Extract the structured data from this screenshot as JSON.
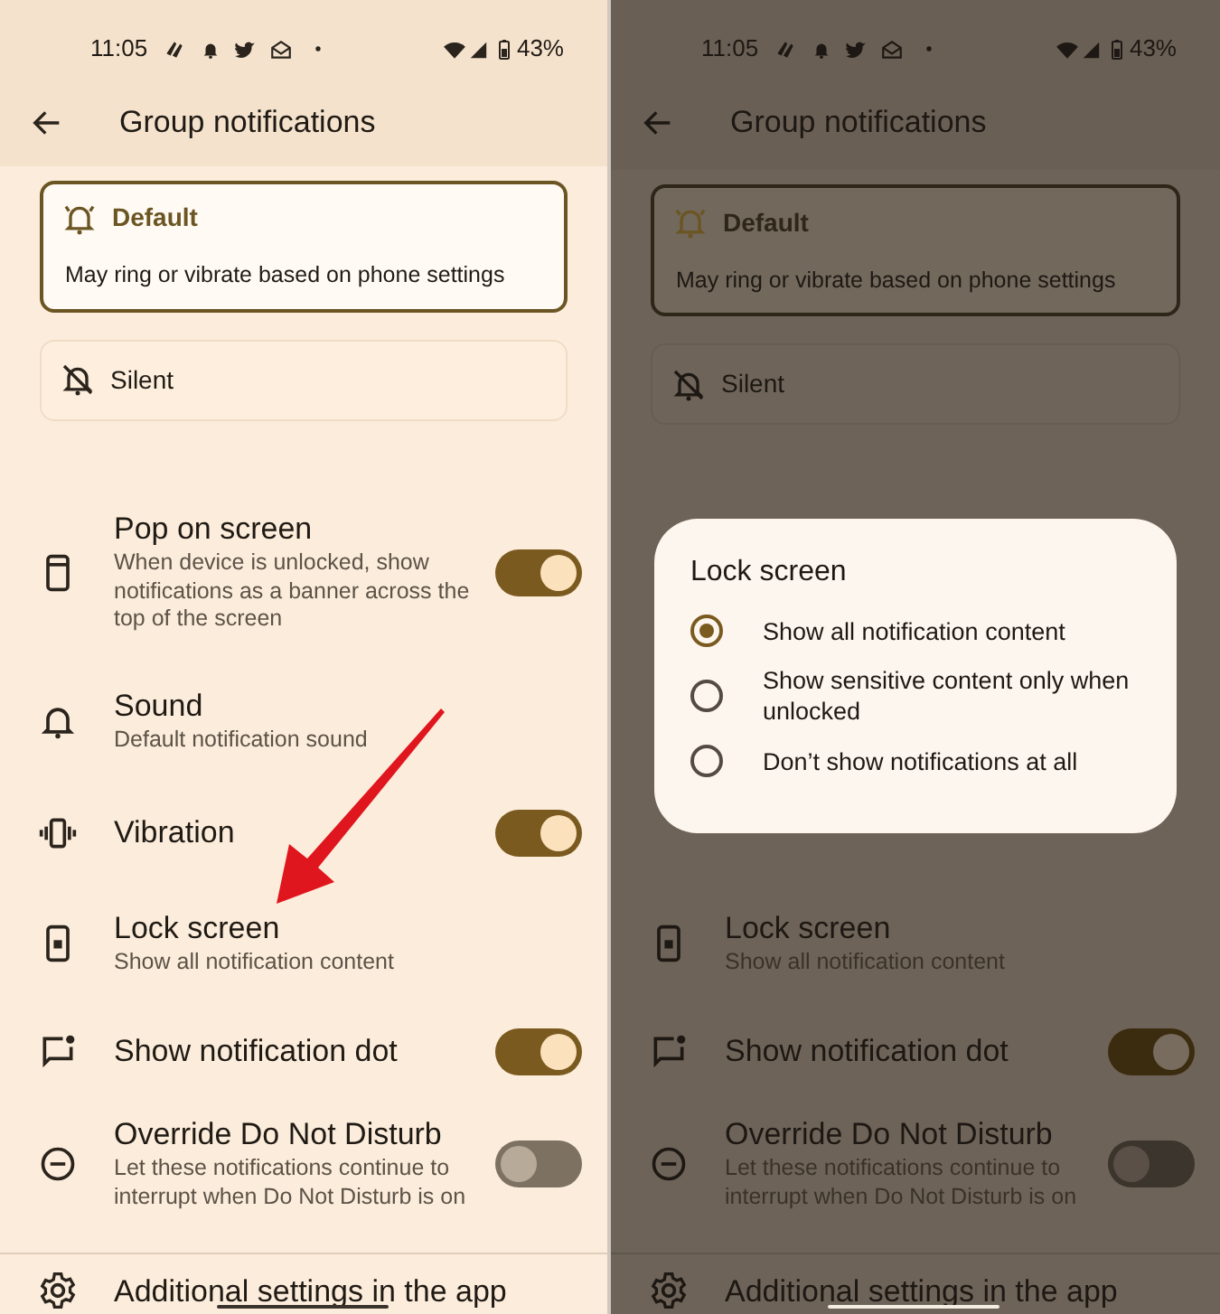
{
  "panels": [
    {
      "scrim": false,
      "status_bar": {
        "time": "11:05",
        "battery": "43%"
      },
      "title": "Group notifications",
      "modes": [
        {
          "label": "Default",
          "description": "May ring or vibrate based on phone settings",
          "selected": true
        },
        {
          "label": "Silent",
          "selected": false
        }
      ],
      "settings": [
        {
          "kind": "popup",
          "title": "Pop on screen",
          "description": "When device is unlocked, show notifications as a banner across the top of the screen",
          "on": true
        },
        {
          "kind": "sound",
          "title": "Sound",
          "description": "Default notification sound"
        },
        {
          "kind": "vibration",
          "title": "Vibration",
          "on": true
        },
        {
          "kind": "lockscreen",
          "title": "Lock screen",
          "description": "Show all notification content"
        },
        {
          "kind": "dot",
          "title": "Show notification dot",
          "on": true
        },
        {
          "kind": "dnd",
          "title": "Override Do Not Disturb",
          "description": "Let these notifications continue to interrupt when Do Not Disturb is on",
          "on": false
        }
      ],
      "footer_link": "Additional settings in the app",
      "annotation_arrow": true
    },
    {
      "scrim": true,
      "status_bar": {
        "time": "11:05",
        "battery": "43%"
      },
      "title": "Group notifications",
      "modes": [
        {
          "label": "Default",
          "description": "May ring or vibrate based on phone settings",
          "selected": true
        },
        {
          "label": "Silent",
          "selected": false
        }
      ],
      "dialog": {
        "title": "Lock screen",
        "options": [
          {
            "label": "Show all notification content",
            "selected": true
          },
          {
            "label": "Show sensitive content only when unlocked",
            "selected": false
          },
          {
            "label": "Don’t show notifications at all",
            "selected": false
          }
        ]
      },
      "settings": [
        {
          "kind": "lockscreen",
          "title": "Lock screen",
          "description": "Show all notification content"
        },
        {
          "kind": "dot",
          "title": "Show notification dot",
          "on": true
        },
        {
          "kind": "dnd",
          "title": "Override Do Not Disturb",
          "description": "Let these notifications continue to interrupt when Do Not Disturb is on",
          "on": false
        }
      ],
      "footer_link": "Additional settings in the app"
    }
  ]
}
